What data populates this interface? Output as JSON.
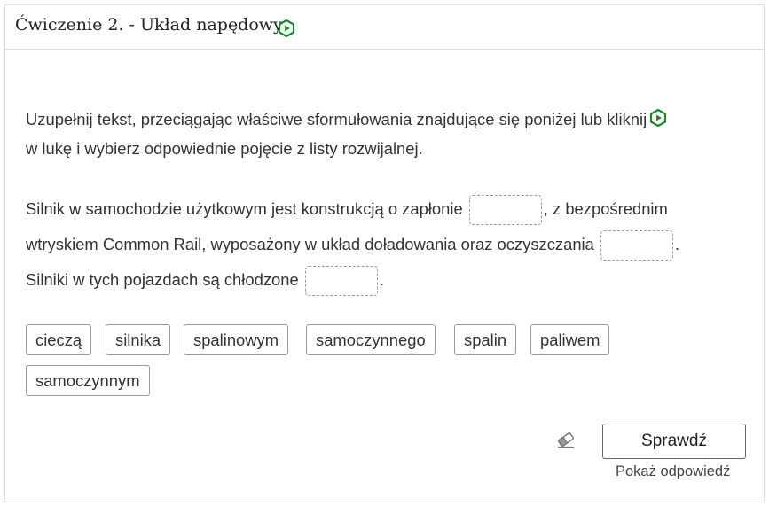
{
  "exercise": {
    "title": "Ćwiczenie 2. - Układ napędowy",
    "title_icon": "hexagon-play-icon"
  },
  "instruction": {
    "line1": "Uzupełnij tekst, przeciągając właściwe sformułowania znajdujące się poniżej lub kliknij",
    "line2": "w lukę i wybierz odpowiednie pojęcie z listy rozwijalnej.",
    "icon": "hexagon-play-icon"
  },
  "paragraph": {
    "part1": "Silnik w samochodzie użytkowym jest konstrukcją o zapłonie",
    "part2": ", z bezpośrednim",
    "part3": "wtryskiem Common Rail, wyposażony w układ doładowania oraz oczyszczania",
    "part4": ".",
    "part5": "Silniki w tych pojazdach są chłodzone",
    "part6": "."
  },
  "options": [
    "cieczą",
    "silnika",
    "spalinowym",
    "samoczynnego",
    "spalin",
    "paliwem",
    "samoczynnym"
  ],
  "actions": {
    "check_label": "Sprawdź",
    "show_answer_label": "Pokaż odpowiedź",
    "eraser_icon": "eraser-icon"
  },
  "colors": {
    "accent_green": "#1a8a2e",
    "border": "#dddddd"
  }
}
